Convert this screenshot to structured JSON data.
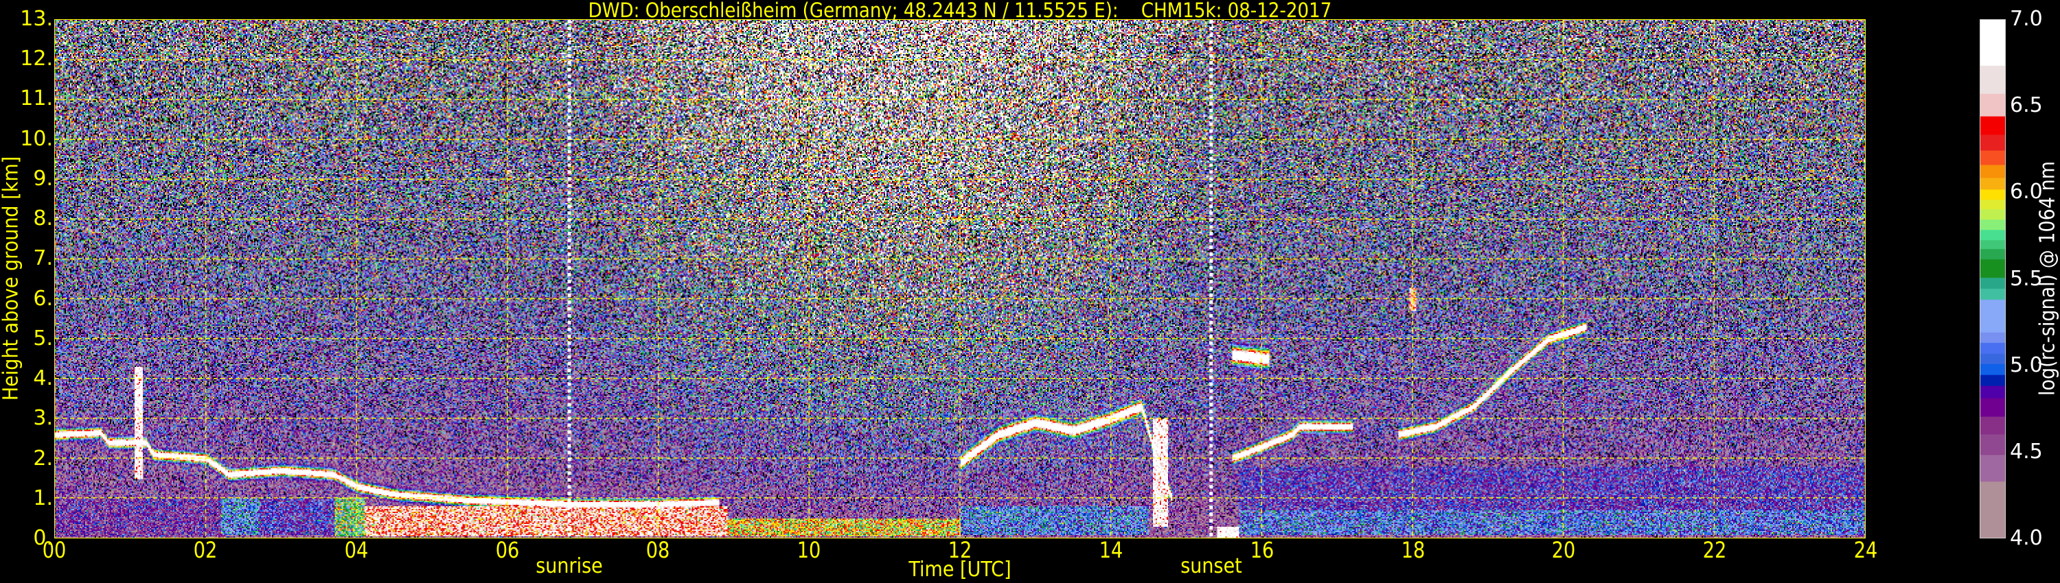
{
  "chart_data": {
    "type": "heatmap",
    "title": "DWD: Oberschleißheim (Germany; 48.2443 N / 11.5525 E):    CHM15k: 08-12-2017",
    "xlabel": "Time [UTC]",
    "ylabel": "Height above ground [km]",
    "colorbar_label": "log(rc-signal) @ 1064 nm",
    "xlim_hours": [
      0,
      24
    ],
    "ylim_km": [
      0,
      13
    ],
    "clim": [
      4.0,
      7.0
    ],
    "grid": true,
    "x_ticks": [
      {
        "value": 0,
        "label": "00"
      },
      {
        "value": 2,
        "label": "02"
      },
      {
        "value": 4,
        "label": "04"
      },
      {
        "value": 6,
        "label": "06"
      },
      {
        "value": 8,
        "label": "08"
      },
      {
        "value": 10,
        "label": "10"
      },
      {
        "value": 12,
        "label": "12"
      },
      {
        "value": 14,
        "label": "14"
      },
      {
        "value": 16,
        "label": "16"
      },
      {
        "value": 18,
        "label": "18"
      },
      {
        "value": 20,
        "label": "20"
      },
      {
        "value": 22,
        "label": "22"
      },
      {
        "value": 24,
        "label": "24"
      }
    ],
    "y_ticks": [
      {
        "value": 0,
        "label": "0."
      },
      {
        "value": 1,
        "label": "1."
      },
      {
        "value": 2,
        "label": "2."
      },
      {
        "value": 3,
        "label": "3."
      },
      {
        "value": 4,
        "label": "4."
      },
      {
        "value": 5,
        "label": "5."
      },
      {
        "value": 6,
        "label": "6."
      },
      {
        "value": 7,
        "label": "7."
      },
      {
        "value": 8,
        "label": "8."
      },
      {
        "value": 9,
        "label": "9."
      },
      {
        "value": 10,
        "label": "10."
      },
      {
        "value": 11,
        "label": "11."
      },
      {
        "value": 12,
        "label": "12."
      },
      {
        "value": 13,
        "label": "13."
      }
    ],
    "colorbar_ticks": [
      {
        "value": 4.0,
        "label": "4.0"
      },
      {
        "value": 4.5,
        "label": "4.5"
      },
      {
        "value": 5.0,
        "label": "5.0"
      },
      {
        "value": 5.5,
        "label": "5.5"
      },
      {
        "value": 6.0,
        "label": "6.0"
      },
      {
        "value": 6.5,
        "label": "6.5"
      },
      {
        "value": 7.0,
        "label": "7.0"
      }
    ],
    "markers": [
      {
        "label": "sunrise",
        "time_hours": 6.82
      },
      {
        "label": "sunset",
        "time_hours": 15.33
      }
    ],
    "colormap": [
      {
        "from": 4.0,
        "color": "#b09098"
      },
      {
        "from": 4.326,
        "color": "#a068a0"
      },
      {
        "from": 4.483,
        "color": "#904890"
      },
      {
        "from": 4.601,
        "color": "#883088"
      },
      {
        "from": 4.702,
        "color": "#700090"
      },
      {
        "from": 4.811,
        "color": "#5000a8"
      },
      {
        "from": 4.88,
        "color": "#0020b0"
      },
      {
        "from": 4.946,
        "color": "#1060e8"
      },
      {
        "from": 5.009,
        "color": "#3868e0"
      },
      {
        "from": 5.069,
        "color": "#4870f0"
      },
      {
        "from": 5.133,
        "color": "#7890f0"
      },
      {
        "from": 5.191,
        "color": "#88a8f8"
      },
      {
        "from": 5.382,
        "color": "#40c0a0"
      },
      {
        "from": 5.444,
        "color": "#28a888"
      },
      {
        "from": 5.506,
        "color": "#189020"
      },
      {
        "from": 5.616,
        "color": "#28a850"
      },
      {
        "from": 5.674,
        "color": "#40c878"
      },
      {
        "from": 5.727,
        "color": "#48e090"
      },
      {
        "from": 5.785,
        "color": "#88f078"
      },
      {
        "from": 5.845,
        "color": "#c0f050"
      },
      {
        "from": 5.903,
        "color": "#e0ec30"
      },
      {
        "from": 5.959,
        "color": "#ffe000"
      },
      {
        "from": 6.019,
        "color": "#f8b010"
      },
      {
        "from": 6.088,
        "color": "#f89008"
      },
      {
        "from": 6.161,
        "color": "#f85020"
      },
      {
        "from": 6.245,
        "color": "#e82020"
      },
      {
        "from": 6.335,
        "color": "#f50000"
      },
      {
        "from": 6.442,
        "color": "#f0c4c4"
      },
      {
        "from": 6.575,
        "color": "#ece0e0"
      },
      {
        "from": 6.736,
        "color": "#ffffff"
      }
    ],
    "cloud_layers_km": [
      {
        "points": [
          [
            0,
            2.6
          ],
          [
            0.6,
            2.65
          ],
          [
            0.7,
            2.4
          ],
          [
            1.2,
            2.4
          ],
          [
            1.3,
            2.1
          ],
          [
            2.0,
            2.0
          ],
          [
            2.3,
            1.6
          ],
          [
            3.0,
            1.7
          ],
          [
            3.7,
            1.6
          ],
          [
            4.0,
            1.3
          ],
          [
            4.5,
            1.1
          ],
          [
            5.5,
            0.95
          ],
          [
            6.8,
            0.85
          ],
          [
            8.0,
            0.85
          ],
          [
            8.8,
            0.9
          ]
        ],
        "thickness": 0.14
      },
      {
        "points": [
          [
            12.0,
            1.9
          ],
          [
            12.5,
            2.6
          ],
          [
            13.0,
            2.9
          ],
          [
            13.5,
            2.7
          ],
          [
            14.0,
            3.0
          ],
          [
            14.4,
            3.3
          ],
          [
            14.6,
            2.0
          ],
          [
            14.8,
            1.0
          ]
        ],
        "thickness": 0.2
      },
      {
        "points": [
          [
            15.6,
            2.0
          ],
          [
            16.0,
            2.3
          ],
          [
            16.4,
            2.6
          ],
          [
            16.5,
            2.8
          ],
          [
            17.2,
            2.8
          ]
        ],
        "thickness": 0.15
      },
      {
        "points": [
          [
            17.8,
            2.6
          ],
          [
            18.3,
            2.8
          ],
          [
            18.8,
            3.3
          ],
          [
            19.3,
            4.2
          ],
          [
            19.8,
            5.0
          ],
          [
            20.3,
            5.3
          ]
        ],
        "thickness": 0.15
      },
      {
        "points": [
          [
            15.6,
            4.6
          ],
          [
            16.1,
            4.5
          ]
        ],
        "thickness": 0.25
      }
    ],
    "columns_km": [
      {
        "t": [
          1.05,
          1.15
        ],
        "h": [
          1.5,
          4.3
        ],
        "value": 6.9
      },
      {
        "t": [
          17.95,
          18.05
        ],
        "h": [
          5.7,
          6.3
        ],
        "value": 6.5
      },
      {
        "t": [
          14.55,
          14.75
        ],
        "h": [
          0.3,
          3.0
        ],
        "value": 6.8
      }
    ],
    "aerosol_regions": [
      {
        "t": [
          0,
          2.2
        ],
        "h": [
          0.05,
          1.0
        ],
        "value": 4.55
      },
      {
        "t": [
          2.2,
          2.7
        ],
        "h": [
          0.1,
          1.0
        ],
        "value": 5.2
      },
      {
        "t": [
          2.7,
          3.7
        ],
        "h": [
          0.1,
          1.0
        ],
        "value": 4.8
      },
      {
        "t": [
          3.7,
          4.1
        ],
        "h": [
          0.05,
          1.0
        ],
        "value": 5.7
      },
      {
        "t": [
          4.1,
          8.9
        ],
        "h": [
          0.05,
          0.8
        ],
        "value": 6.5
      },
      {
        "t": [
          8.9,
          12.0
        ],
        "h": [
          0.05,
          0.5
        ],
        "value": 6.0
      },
      {
        "t": [
          12.0,
          14.5
        ],
        "h": [
          0.1,
          0.8
        ],
        "value": 5.15
      },
      {
        "t": [
          15.7,
          24.0
        ],
        "h": [
          0.7,
          1.8
        ],
        "value": 4.75
      },
      {
        "t": [
          15.7,
          24.0
        ],
        "h": [
          0.1,
          0.7
        ],
        "value": 5.1
      },
      {
        "t": [
          15.4,
          15.7
        ],
        "h": [
          0.0,
          0.3
        ],
        "value": 7.0
      }
    ]
  }
}
